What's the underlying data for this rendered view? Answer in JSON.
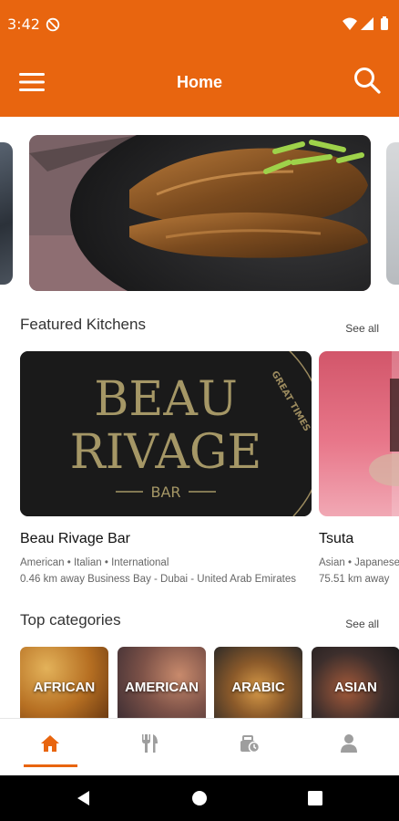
{
  "status_bar": {
    "time": "3:42",
    "icons": [
      "dnd-icon",
      "wifi-icon",
      "signal-icon",
      "battery-icon"
    ]
  },
  "app_bar": {
    "title": "Home",
    "menu_icon": "hamburger-menu-icon",
    "search_icon": "search-icon",
    "background_color": "#e8650f"
  },
  "featured_kitchens": {
    "title": "Featured Kitchens",
    "see_all": "See all",
    "items": [
      {
        "name": "Beau Rivage Bar",
        "cuisines": "American • Italian • International",
        "location": "0.46 km away Business Bay - Dubai - United Arab Emirates",
        "logo_text": {
          "line1": "BEAU",
          "line2": "RIVAGE",
          "line3": "BAR",
          "tagline": "GREAT TIMES"
        }
      },
      {
        "name": "Tsuta",
        "cuisines": "Asian • Japanese",
        "location": "75.51 km away"
      }
    ]
  },
  "top_categories": {
    "title": "Top categories",
    "see_all": "See all",
    "items": [
      {
        "label": "AFRICAN"
      },
      {
        "label": "AMERICAN"
      },
      {
        "label": "ARABIC"
      },
      {
        "label": "ASIAN"
      }
    ]
  },
  "bottom_nav": {
    "active": "home",
    "active_color": "#e8650f",
    "items": [
      {
        "icon": "home-icon"
      },
      {
        "icon": "fork-knife-icon"
      },
      {
        "icon": "orders-icon"
      },
      {
        "icon": "profile-icon"
      }
    ]
  },
  "system_nav": {
    "buttons": [
      "back-icon",
      "home-circle-icon",
      "recents-square-icon"
    ]
  }
}
